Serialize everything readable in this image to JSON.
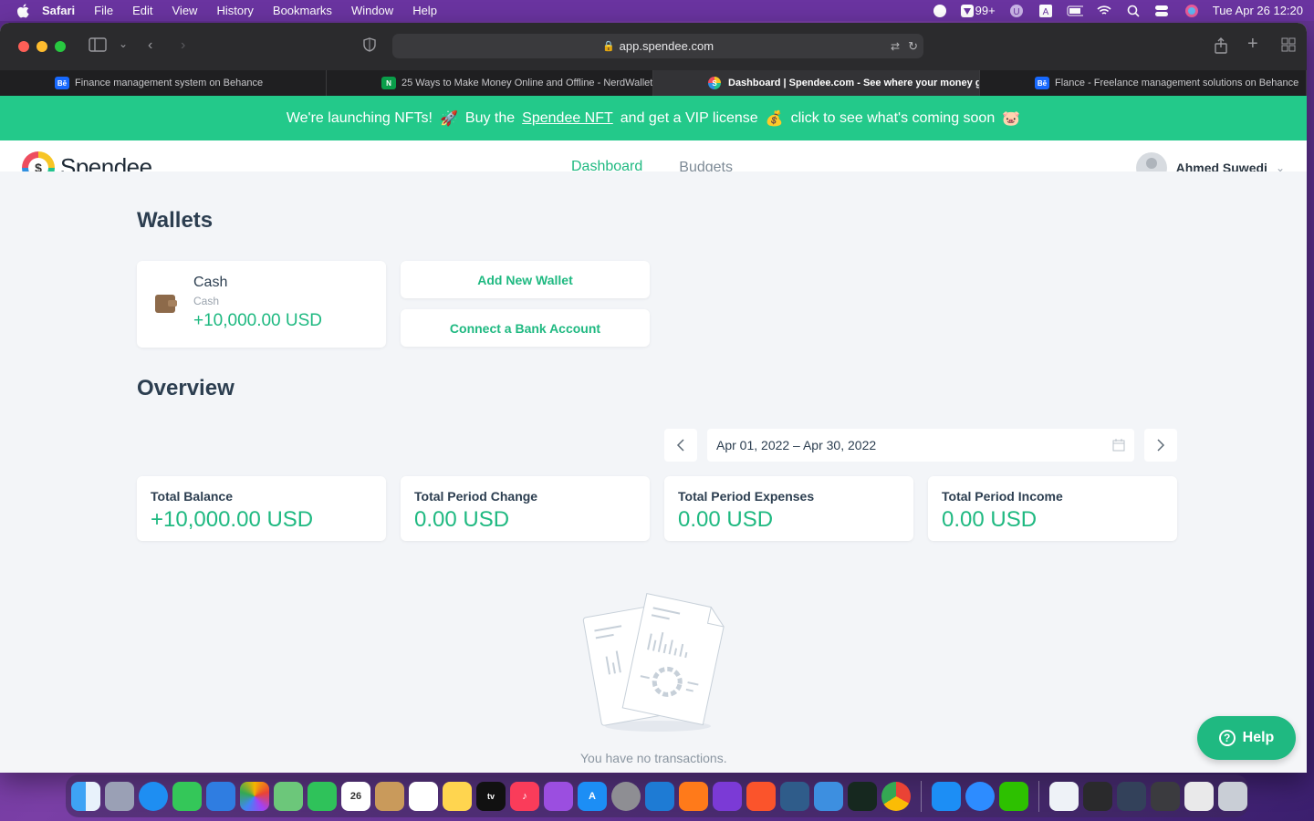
{
  "menubar": {
    "app": "Safari",
    "items": [
      "File",
      "Edit",
      "View",
      "History",
      "Bookmarks",
      "Window",
      "Help"
    ],
    "badge_count": "99+",
    "datetime": "Tue Apr 26  12:20"
  },
  "browser": {
    "url": "app.spendee.com",
    "tabs": [
      {
        "label": "Finance management system on Behance",
        "icon": "behance-icon",
        "color": "#1769ff",
        "glyph": "Bē"
      },
      {
        "label": "25 Ways to Make Money Online and Offline - NerdWallet",
        "icon": "nerdwallet-icon",
        "color": "#0a9e4a",
        "glyph": "N"
      },
      {
        "label": "Dashboard | Spendee.com - See where your money go...",
        "icon": "spendee-favicon",
        "color": "#f7c525",
        "glyph": "S"
      },
      {
        "label": "Flance - Freelance management solutions on Behance",
        "icon": "behance-icon",
        "color": "#1769ff",
        "glyph": "Bē"
      }
    ],
    "active_tab": 2
  },
  "promo": {
    "part1": "We're launching NFTs!",
    "emoji1": "🚀",
    "part2": "Buy the",
    "link": "Spendee NFT",
    "part3": "and get a VIP license",
    "emoji2": "💰",
    "part4": "click to see what's coming soon",
    "emoji3": "🐷"
  },
  "app": {
    "logo_text": "Spendee",
    "nav": [
      "Dashboard",
      "Budgets"
    ],
    "user": "Ahmed Suwedi"
  },
  "wallets": {
    "title": "Wallets",
    "card": {
      "name": "Cash",
      "type": "Cash",
      "amount": "+10,000.00 USD"
    },
    "add_wallet": "Add New Wallet",
    "connect_bank": "Connect a Bank Account"
  },
  "overview": {
    "title": "Overview",
    "date_range": "Apr 01, 2022 – Apr 30, 2022",
    "stats": [
      {
        "label": "Total Balance",
        "value": "+10,000.00 USD"
      },
      {
        "label": "Total Period Change",
        "value": "0.00 USD"
      },
      {
        "label": "Total Period Expenses",
        "value": "0.00 USD"
      },
      {
        "label": "Total Period Income",
        "value": "0.00 USD"
      }
    ],
    "empty_text": "You have no transactions."
  },
  "help": {
    "label": "Help"
  },
  "colors": {
    "accent": "#1fb981",
    "promo": "#23c98a"
  }
}
